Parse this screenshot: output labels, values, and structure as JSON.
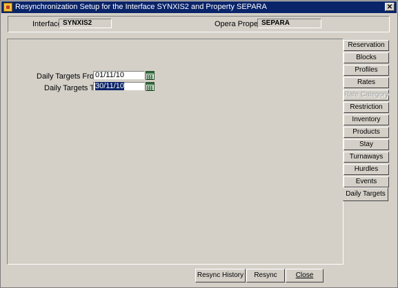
{
  "window": {
    "title": "Resynchronization Setup for the Interface SYNXIS2 and Property SEPARA",
    "close_glyph": "✕"
  },
  "header": {
    "interface_label": "Interface",
    "interface_value": "SYNXIS2",
    "property_label": "Opera Property",
    "property_value": "SEPARA"
  },
  "form": {
    "from_label": "Daily Targets From",
    "from_value": "01/11/10",
    "to_label": "Daily Targets To",
    "to_value": "30/11/10"
  },
  "tabs": [
    {
      "label": "Reservation",
      "state": "normal"
    },
    {
      "label": "Blocks",
      "state": "normal"
    },
    {
      "label": "Profiles",
      "state": "normal"
    },
    {
      "label": "Rates",
      "state": "normal"
    },
    {
      "label": "Rate Category",
      "state": "disabled"
    },
    {
      "label": "Restriction",
      "state": "normal"
    },
    {
      "label": "Inventory",
      "state": "normal"
    },
    {
      "label": "Products",
      "state": "normal"
    },
    {
      "label": "Stay",
      "state": "normal"
    },
    {
      "label": "Turnaways",
      "state": "normal"
    },
    {
      "label": "Hurdles",
      "state": "normal"
    },
    {
      "label": "Events",
      "state": "normal"
    },
    {
      "label": "Daily Targets",
      "state": "active"
    }
  ],
  "buttons": {
    "resync_history": "Resync History",
    "resync": "Resync",
    "close": "Close"
  },
  "icons": {
    "app": "oracle-app-icon",
    "calendar": "calendar-icon",
    "close": "close-icon"
  },
  "colors": {
    "titlebar": "#0a246a",
    "face": "#d4d0c8",
    "selection": "#0a246a"
  }
}
